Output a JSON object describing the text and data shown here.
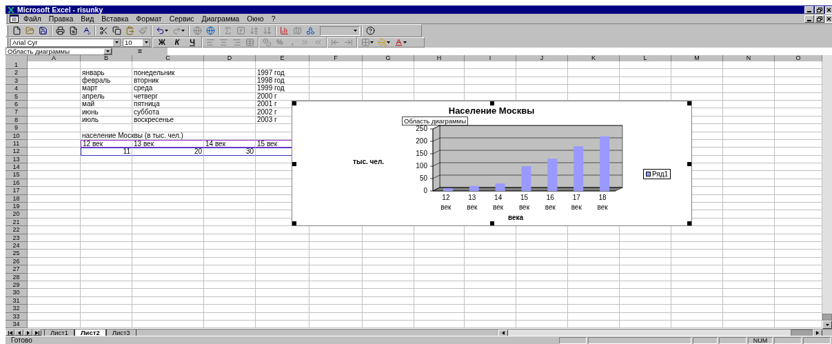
{
  "window": {
    "title": "Microsoft Excel - risunky"
  },
  "menu": [
    "Файл",
    "Правка",
    "Вид",
    "Вставка",
    "Формат",
    "Сервис",
    "Диаграмма",
    "Окно",
    "?"
  ],
  "formatting": {
    "font": "Arial Cyr",
    "size": "10",
    "style_buttons": [
      "Ж",
      "К",
      "Ч"
    ],
    "number_buttons": [
      "%",
      ","
    ]
  },
  "name_box": "Область диаграммы",
  "formula_button": "=",
  "columns": [
    "A",
    "B",
    "C",
    "D",
    "E",
    "F",
    "G",
    "H",
    "I",
    "J",
    "K",
    "L",
    "M",
    "N",
    "O"
  ],
  "rows": [
    {
      "number": "1"
    },
    {
      "number": "2",
      "kind": "text",
      "cells": [
        null,
        "январь",
        "понедельник",
        null,
        "1997 год"
      ]
    },
    {
      "number": "3",
      "kind": "text",
      "cells": [
        null,
        "февраль",
        "вторник",
        null,
        "1998 год"
      ]
    },
    {
      "number": "4",
      "kind": "text",
      "cells": [
        null,
        "март",
        "среда",
        null,
        "1999 год"
      ]
    },
    {
      "number": "5",
      "kind": "text",
      "cells": [
        null,
        "апрель",
        "четверг",
        null,
        "2000 г"
      ]
    },
    {
      "number": "6",
      "kind": "text",
      "cells": [
        null,
        "май",
        "пятница",
        null,
        "2001 г"
      ]
    },
    {
      "number": "7",
      "kind": "text",
      "cells": [
        null,
        "июнь",
        "суббота",
        null,
        "2002 г"
      ]
    },
    {
      "number": "8",
      "kind": "text",
      "cells": [
        null,
        "июль",
        "воскресенье",
        null,
        "2003 г"
      ]
    },
    {
      "number": "9"
    },
    {
      "number": "10",
      "kind": "text",
      "cells": [
        null,
        "население Москвы (в тыс. чел.)"
      ]
    },
    {
      "number": "11",
      "kind": "text",
      "color": "#9933cc",
      "cells": [
        null,
        "12 век",
        "13 век",
        "14 век",
        "15 век"
      ]
    },
    {
      "number": "12",
      "kind": "number",
      "color": "#3333cc",
      "cells": [
        null,
        "11",
        "20",
        "30"
      ]
    },
    {
      "number": "13"
    },
    {
      "number": "14"
    },
    {
      "number": "15"
    },
    {
      "number": "16"
    },
    {
      "number": "17"
    },
    {
      "number": "18"
    },
    {
      "number": "19"
    },
    {
      "number": "20"
    },
    {
      "number": "21"
    },
    {
      "number": "22"
    },
    {
      "number": "23"
    },
    {
      "number": "24"
    },
    {
      "number": "25"
    },
    {
      "number": "26"
    },
    {
      "number": "27"
    },
    {
      "number": "28"
    },
    {
      "number": "29"
    },
    {
      "number": "30"
    },
    {
      "number": "31"
    },
    {
      "number": "32"
    },
    {
      "number": "33"
    },
    {
      "number": "34"
    }
  ],
  "chart": {
    "tooltip": "Область диаграммы",
    "chart_data": {
      "type": "bar",
      "title": "Население Москвы",
      "xlabel": "века",
      "ylabel": "тыс. чел.",
      "categories": [
        "12 век",
        "13 век",
        "14 век",
        "15 век",
        "16 век",
        "17 век",
        "18 век"
      ],
      "series": [
        {
          "name": "Ряд1",
          "color": "#9999ff",
          "values": [
            11,
            20,
            30,
            100,
            130,
            180,
            220
          ]
        }
      ],
      "ylim": [
        0,
        250
      ],
      "yticks": [
        0,
        50,
        100,
        150,
        200,
        250
      ]
    }
  },
  "sheet_tabs": [
    {
      "label": "Лист1",
      "selected": false
    },
    {
      "label": "Лист2",
      "selected": true
    },
    {
      "label": "Лист3",
      "selected": false
    }
  ],
  "status_bar": {
    "text": "Готово",
    "indicators": [
      "NUM"
    ]
  }
}
